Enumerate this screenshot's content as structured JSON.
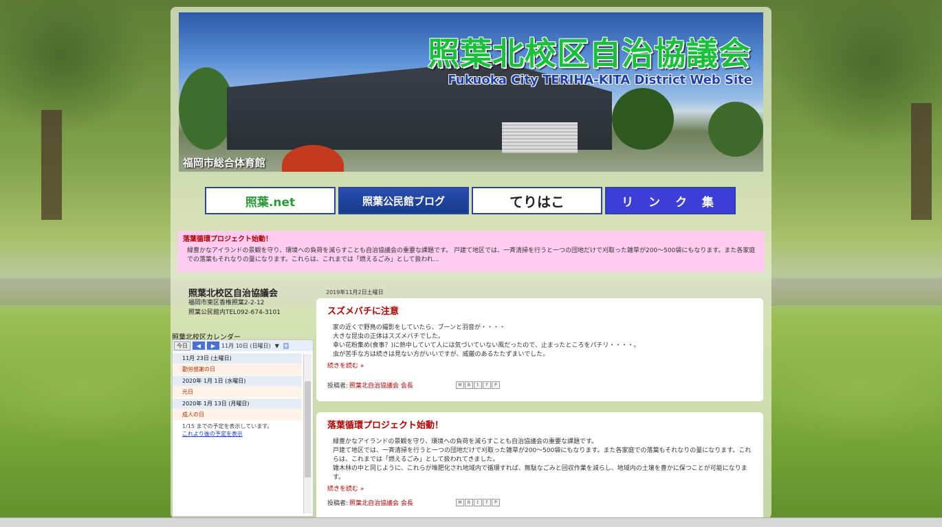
{
  "header": {
    "title": "照葉北校区自治協議会",
    "subtitle": "Fukuoka City TERIHA-KITA District Web Site",
    "caption": "福岡市総合体育館"
  },
  "banners": [
    {
      "label": "照葉.net"
    },
    {
      "label": "照葉公民館ブログ"
    },
    {
      "label": "てりはこ"
    },
    {
      "label": "リ ン ク 集"
    }
  ],
  "notice": {
    "title": "落葉循環プロジェクト始動！",
    "body": "緑豊かなアイランドの景観を守り、環境への負荷を減らすことも自治協議会の重要な課題です。 戸建て地区では、一斉清掃を行うと一つの団地だけで刈取った雑草が200～500袋にもなります。また各家庭での落葉もそれなりの量になります。これらは、これまでは「燃えるごみ」として扱われ..."
  },
  "sidebar": {
    "org_name": "照葉北校区自治協議会",
    "address": "福岡市東区香椎照葉2-2-12",
    "phone": "照葉公民館内TEL092-674-3101",
    "calendar_title": "照葉北校区カレンダー",
    "today_label": "今日",
    "current_date": "11月 10日 (日曜日)",
    "events": [
      {
        "date": "11月 23日 (土曜日)",
        "title": "勤労感謝の日"
      },
      {
        "date": "2020年 1月 1日 (水曜日)",
        "title": "元日"
      },
      {
        "date": "2020年 1月 13日 (月曜日)",
        "title": "成人の日"
      }
    ],
    "footer_text": "1/15 までの予定を表示しています。",
    "footer_link": "これより後の予定を表示"
  },
  "posts": {
    "date_header": "2019年11月2日土曜日",
    "items": [
      {
        "title": "スズメバチに注意",
        "lines": [
          "家の近くで野鳥の撮影をしていたら、ブーンと羽音が・・・・",
          "大きな昆虫の正体はスズメバチでした。",
          "幸い花粉集め(食事？)に熱中していて人には気づいていない風だったので、止まったところをパチリ・・・・。",
          "虫が苦手な方は続きは見ない方がいいですが、威厳のあるたたずまいでした。"
        ],
        "more": "続きを読む »",
        "author_label": "投稿者:",
        "author": "照葉北自治協議会 会長"
      },
      {
        "title": "落葉循環プロジェクト始動！",
        "lines": [
          "緑豊かなアイランドの景観を守り、環境への負荷を減らすことも自治協議会の重要な課題です。",
          "戸建て地区では、一斉清掃を行うと一つの団地だけで刈取った雑草が200～500袋にもなります。また各家庭での落葉もそれなりの量になります。これらは、これまでは「燃えるごみ」として扱われてきました。",
          "雑木林の中と同じように、これらが堆肥化され地域内で循環すれば、無駄なごみと回収作業を減らし、地域内の土壌を豊かに保つことが可能になります。"
        ],
        "more": "続きを読む »",
        "author_label": "投稿者:",
        "author": "照葉北自治協議会 会長"
      }
    ]
  }
}
